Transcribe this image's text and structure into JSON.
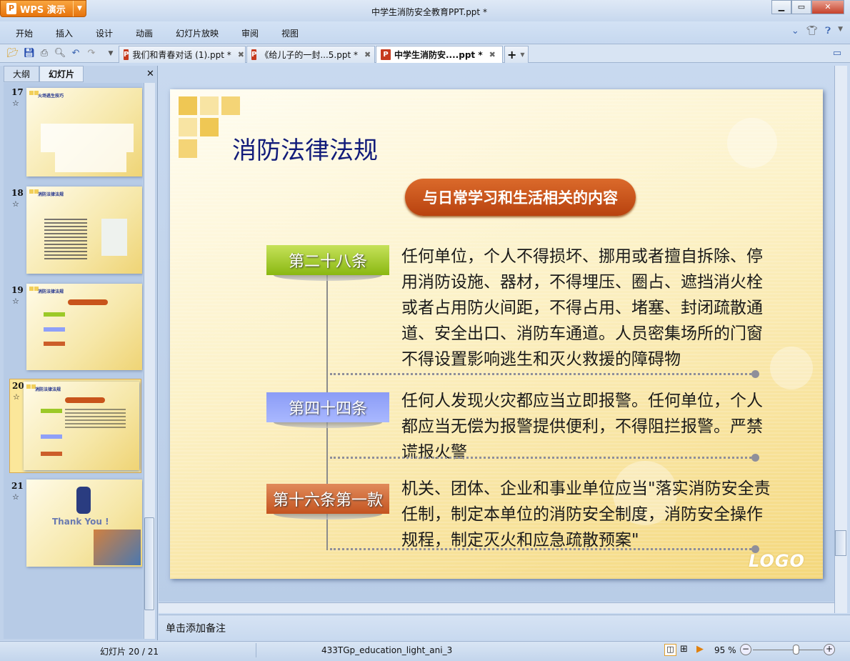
{
  "app": {
    "name": "WPS 演示",
    "window_title": "中学生消防安全教育PPT.ppt *"
  },
  "menu": [
    "开始",
    "插入",
    "设计",
    "动画",
    "幻灯片放映",
    "审阅",
    "视图"
  ],
  "doc_tabs": [
    {
      "label": "我们和青春对话 (1).ppt *"
    },
    {
      "label": "《给儿子的一封...5.ppt *"
    },
    {
      "label": "中学生消防安....ppt *",
      "active": true
    }
  ],
  "left_panel": {
    "tabs": [
      "大纲",
      "幻灯片"
    ],
    "active_tab": "幻灯片",
    "thumbs": [
      {
        "num": "17",
        "title": "火场逃生技巧"
      },
      {
        "num": "18",
        "title": "消防法律法规"
      },
      {
        "num": "19",
        "title": "消防法律法规"
      },
      {
        "num": "20",
        "title": "消防法律法规",
        "selected": true
      },
      {
        "num": "21",
        "title": "Thank You !"
      }
    ]
  },
  "slide": {
    "title": "消防法律法规",
    "subtitle": "与日常学习和生活相关的内容",
    "articles": [
      {
        "label": "第二十八条",
        "text": "任何单位，个人不得损坏、挪用或者擅自拆除、停用消防设施、器材，不得埋压、圈占、遮挡消火栓或者占用防火间距，不得占用、堵塞、封闭疏散通道、安全出口、消防车通道。人员密集场所的门窗不得设置影响逃生和灭火救援的障碍物",
        "color": "#9cc928"
      },
      {
        "label": "第四十四条",
        "text": "任何人发现火灾都应当立即报警。任何单位，个人都应当无偿为报警提供便利，不得阻拦报警。严禁谎报火警",
        "color": "#8fa0f8"
      },
      {
        "label": "第十六条第一款",
        "text": "机关、团体、企业和事业单位应当\"落实消防安全责任制，制定本单位的消防安全制度，消防安全操作规程，制定灭火和应急疏散预案\"",
        "color": "#cc5e2a"
      }
    ],
    "logo": "LOGO"
  },
  "notes_placeholder": "单击添加备注",
  "status": {
    "slide_pos": "幻灯片 20 / 21",
    "template": "433TGp_education_light_ani_3",
    "zoom": "95 %",
    "zoom_percent": 95
  }
}
